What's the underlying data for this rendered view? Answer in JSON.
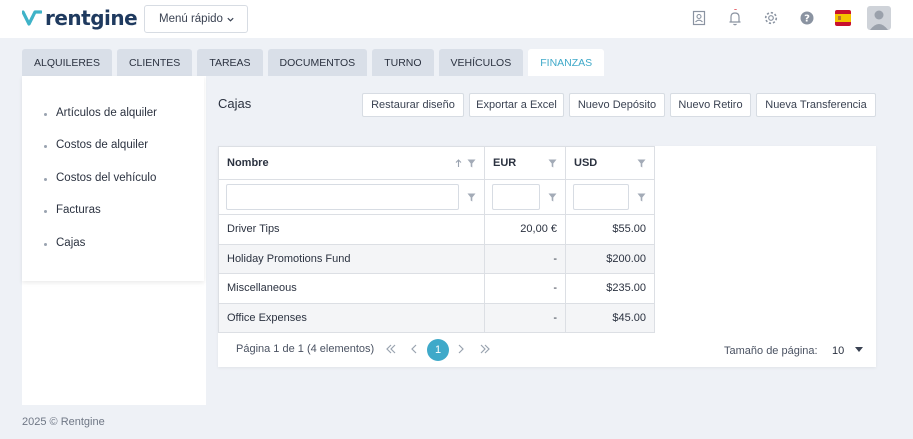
{
  "header": {
    "brand": "rentgine",
    "quick_menu": "Menú rápido"
  },
  "tabs": [
    {
      "label": "ALQUILERES",
      "active": false
    },
    {
      "label": "CLIENTES",
      "active": false
    },
    {
      "label": "TAREAS",
      "active": false
    },
    {
      "label": "DOCUMENTOS",
      "active": false
    },
    {
      "label": "TURNO",
      "active": false
    },
    {
      "label": "VEHÍCULOS",
      "active": false
    },
    {
      "label": "FINANZAS",
      "active": true
    }
  ],
  "sidebar": {
    "items": [
      {
        "label": "Artículos de alquiler"
      },
      {
        "label": "Costos de alquiler"
      },
      {
        "label": "Costos del vehículo"
      },
      {
        "label": "Facturas"
      },
      {
        "label": "Cajas"
      }
    ]
  },
  "main": {
    "title": "Cajas",
    "buttons": {
      "restore": "Restaurar diseño",
      "export": "Exportar a Excel",
      "deposit": "Nuevo Depósito",
      "withdraw": "Nuevo Retiro",
      "transfer": "Nueva Transferencia"
    }
  },
  "grid": {
    "columns": [
      "Nombre",
      "EUR",
      "USD"
    ],
    "filters": {
      "name": "",
      "eur": "",
      "usd": ""
    },
    "rows": [
      {
        "name": "Driver Tips",
        "eur": "20,00 €",
        "usd": "$55.00"
      },
      {
        "name": "Holiday Promotions Fund",
        "eur": "-",
        "usd": "$200.00"
      },
      {
        "name": "Miscellaneous",
        "eur": "-",
        "usd": "$235.00"
      },
      {
        "name": "Office Expenses",
        "eur": "-",
        "usd": "$45.00"
      }
    ]
  },
  "pager": {
    "info": "Página 1 de 1 (4 elementos)",
    "current": "1",
    "page_size_label": "Tamaño de página:",
    "page_size": "10"
  },
  "footer": {
    "text": "2025 © Rentgine"
  },
  "colors": {
    "accent": "#3fa9c9",
    "brand": "#1f3a5f",
    "logo_mark": "#3fb3c8",
    "notification_dot": "#e0343f"
  },
  "icons": {
    "header": [
      "contacts-icon",
      "bell-icon",
      "gear-icon",
      "help-icon",
      "spain-flag-icon",
      "user-avatar-icon"
    ],
    "grid": [
      "sort-asc-icon",
      "filter-icon"
    ],
    "pager": [
      "first-page-icon",
      "prev-page-icon",
      "next-page-icon",
      "last-page-icon"
    ]
  }
}
